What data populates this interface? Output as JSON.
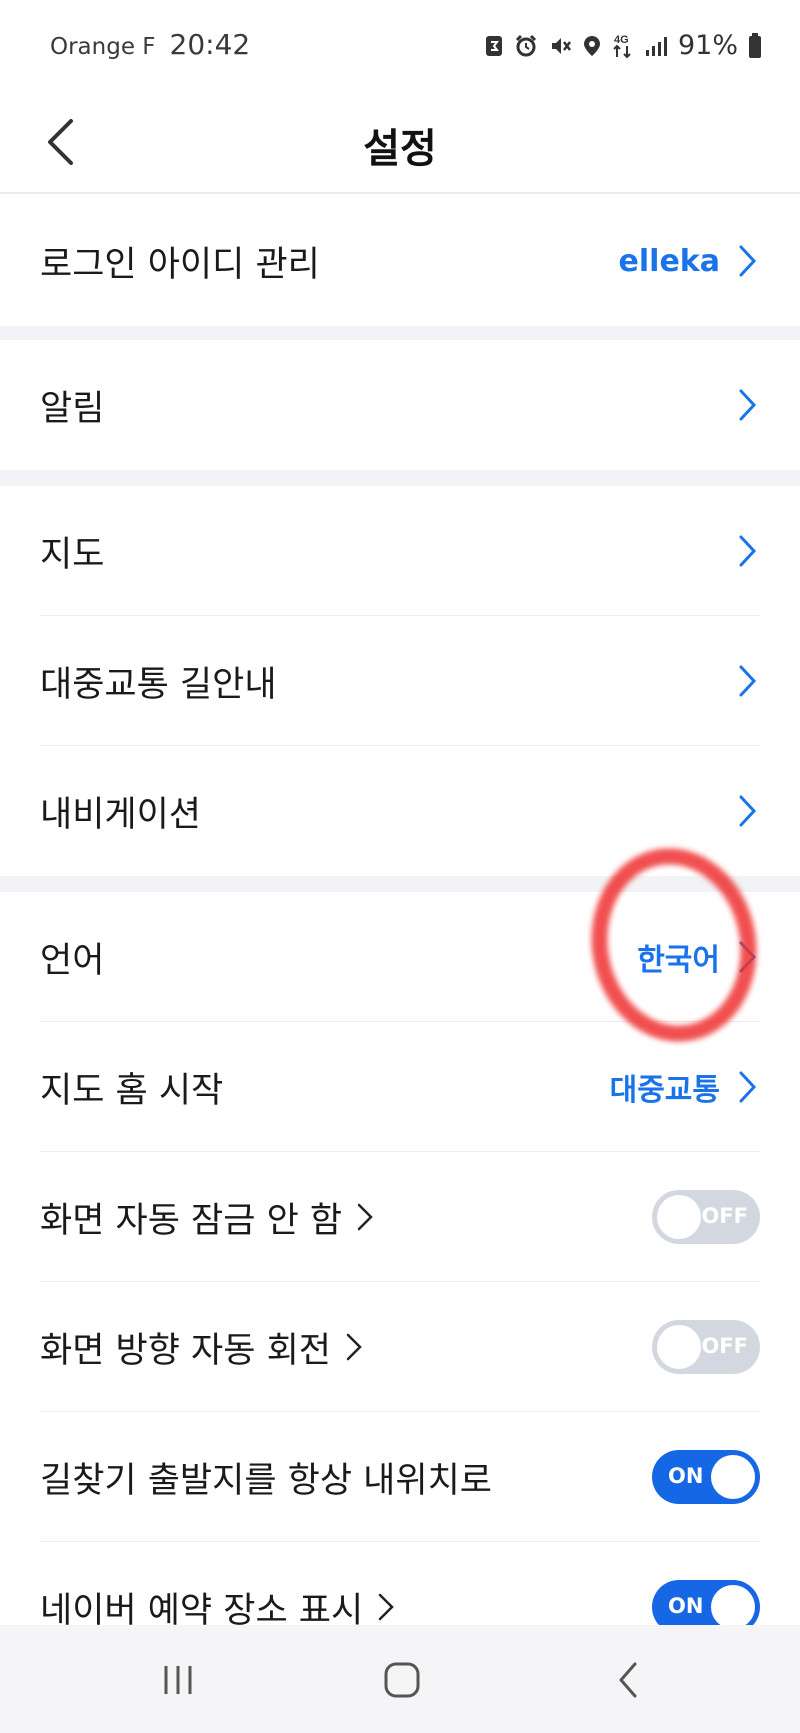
{
  "status_bar": {
    "carrier": "Orange F",
    "time": "20:42",
    "battery_percent": "91%",
    "network": "4G",
    "icons": [
      "sync-icon",
      "alarm-icon",
      "mute-vibrate-icon",
      "location-icon",
      "4g-data-icon",
      "signal-icon",
      "battery-icon"
    ]
  },
  "header": {
    "title": "설정",
    "back_icon": "chevron-left-icon"
  },
  "groups": {
    "account": {
      "login_id": {
        "label": "로그인 아이디 관리",
        "value": "elleka"
      }
    },
    "notifications": {
      "alarm": {
        "label": "알림"
      }
    },
    "map_settings": {
      "map": {
        "label": "지도"
      },
      "transit": {
        "label": "대중교통 길안내"
      },
      "navigation": {
        "label": "내비게이션"
      }
    },
    "general": {
      "language": {
        "label": "언어",
        "value": "한국어"
      },
      "map_home_start": {
        "label": "지도 홈 시작",
        "value": "대중교통"
      },
      "screen_lock": {
        "label": "화면 자동 잠금 안 함",
        "toggle": "OFF",
        "on": false
      },
      "auto_rotate": {
        "label": "화면 방향 자동 회전",
        "toggle": "OFF",
        "on": false
      },
      "start_my_location": {
        "label": "길찾기 출발지를 항상 내위치로",
        "toggle": "ON",
        "on": true
      },
      "naver_booking": {
        "label": "네이버 예약 장소 표시",
        "toggle": "ON",
        "on": true
      }
    }
  },
  "colors": {
    "accent": "#1a73e8",
    "toggle_on": "#1667e6",
    "toggle_off": "#d3d7df",
    "section_gap": "#f2f3f6",
    "annotation": "#ee3030"
  },
  "navbar": {
    "icons": [
      "recent-apps-icon",
      "home-icon",
      "back-icon"
    ]
  }
}
